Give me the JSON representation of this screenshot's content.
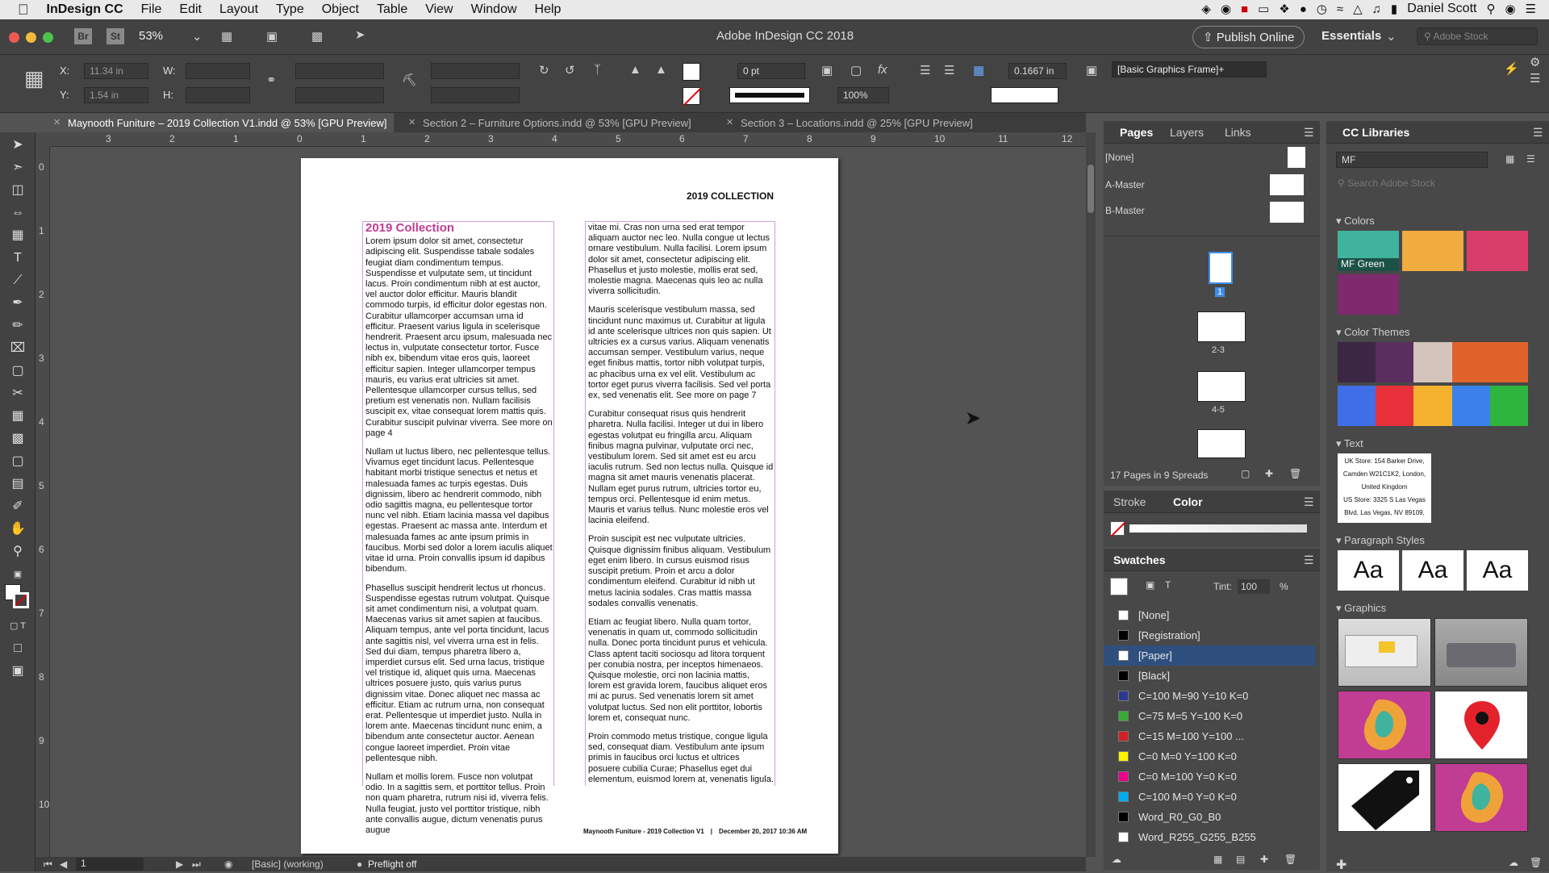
{
  "menubar": {
    "app_name": "InDesign CC",
    "items": [
      "File",
      "Edit",
      "Layout",
      "Type",
      "Object",
      "Table",
      "View",
      "Window",
      "Help"
    ],
    "user": "Daniel Scott"
  },
  "appbar": {
    "bridge": "Br",
    "stock": "St",
    "zoom": "53%",
    "window_title": "Adobe InDesign CC 2018",
    "publish": "Publish Online",
    "workspace": "Essentials",
    "search_placeholder": "Adobe Stock"
  },
  "control": {
    "x_label": "X:",
    "x_value": "11.34 in",
    "y_label": "Y:",
    "y_value": "1.54 in",
    "w_label": "W:",
    "h_label": "H:",
    "stroke_weight": "0 pt",
    "opacity": "100%",
    "gap": "0.1667 in",
    "object_style": "[Basic Graphics Frame]+"
  },
  "tabs": [
    "Maynooth Funiture – 2019 Collection V1.indd @ 53% [GPU Preview]",
    "Section 2 – Furniture Options.indd @ 53% [GPU Preview]",
    "Section 3 – Locations.indd @ 25% [GPU Preview]"
  ],
  "rulers": {
    "h": [
      "4",
      "3",
      "2",
      "1",
      "0",
      "1",
      "2",
      "3",
      "4",
      "5",
      "6",
      "7",
      "8",
      "9",
      "10",
      "11",
      "12"
    ],
    "v": [
      "0",
      "1",
      "2",
      "3",
      "4",
      "5",
      "6",
      "7",
      "8",
      "9",
      "10"
    ]
  },
  "document": {
    "header": "2019 COLLECTION",
    "title": "2019 Collection",
    "left_paras": [
      "Lorem ipsum dolor sit amet, consectetur adipiscing elit. Suspendisse tabale sodales feugiat diam condimentum tempus. Suspendisse et vulputate sem, ut tincidunt lacus. Proin condimentum nibh at est auctor, vel auctor dolor efficitur. Mauris blandit commodo turpis, id efficitur dolor egestas non. Curabitur ullamcorper accumsan urna id efficitur. Praesent varius ligula in scelerisque hendrerit. Praesent arcu ipsum, malesuada nec lectus in, vulputate consectetur tortor. Fusce nibh ex, bibendum vitae eros quis, laoreet efficitur sapien. Integer ullamcorper tempus mauris, eu varius erat ultricies sit amet. Pellentesque ullamcorper cursus tellus, sed pretium est venenatis non. Nullam facilisis suscipit ex, vitae consequat lorem mattis quis. Curabitur suscipit pulvinar viverra. See more on page 4",
      "Nullam ut luctus libero, nec pellentesque tellus. Vivamus eget tincidunt lacus. Pellentesque habitant morbi tristique senectus et netus et malesuada fames ac turpis egestas. Duis dignissim, libero ac hendrerit commodo, nibh odio sagittis magna, eu pellentesque tortor nunc vel nibh. Etiam lacinia massa vel dapibus egestas. Praesent ac massa ante. Interdum et malesuada fames ac ante ipsum primis in faucibus. Morbi sed dolor a lorem iaculis aliquet vitae id urna. Proin convallis ipsum id dapibus bibendum.",
      "Phasellus suscipit hendrerit lectus ut rhoncus. Suspendisse egestas rutrum volutpat. Quisque sit amet condimentum nisi, a volutpat quam. Maecenas varius sit amet sapien at faucibus. Aliquam tempus, ante vel porta tincidunt, lacus ante sagittis nisl, vel viverra urna est in felis. Sed dui diam, tempus pharetra libero a, imperdiet cursus elit. Sed urna lacus, tristique vel tristique id, aliquet quis urna. Maecenas ultrices posuere justo, quis varius purus dignissim vitae. Donec aliquet nec massa ac efficitur. Etiam ac rutrum urna, non consequat erat. Pellentesque ut imperdiet justo. Nulla in lorem ante. Maecenas tincidunt nunc enim, a bibendum ante consectetur auctor. Aenean congue laoreet imperdiet. Proin vitae pellentesque nibh.",
      "Nullam et mollis lorem. Fusce non volutpat odio. In a sagittis sem, et porttitor tellus. Proin non quam pharetra, rutrum nisi id, viverra felis. Nulla feugiat, justo vel porttitor tristique, nibh ante convallis augue, dictum venenatis purus augue"
    ],
    "right_paras": [
      "vitae mi. Cras non urna sed erat tempor aliquam auctor nec leo. Nulla congue ut lectus ornare vestibulum. Nulla facilisi. Lorem ipsum dolor sit amet, consectetur adipiscing elit. Phasellus et justo molestie, mollis erat sed, molestie magna. Maecenas quis leo ac nulla viverra sollicitudin.",
      "Mauris scelerisque vestibulum massa, sed tincidunt nunc maximus ut. Curabitur at ligula id ante scelerisque ultrices non quis sapien. Ut ultricies ex a cursus varius. Aliquam venenatis accumsan semper. Vestibulum varius, neque eget finibus mattis, tortor nibh volutpat turpis, ac phacibus urna ex vel elit. Vestibulum ac tortor eget purus viverra facilisis. Sed vel porta ex, sed venenatis elit. See more on page 7",
      "Curabitur consequat risus quis hendrerit pharetra. Nulla facilisi. Integer ut dui in libero egestas volutpat eu fringilla arcu. Aliquam finibus magna pulvinar, vulputate orci nec, vestibulum lorem. Sed sit amet est eu arcu iaculis rutrum. Sed non lectus nulla. Quisque id magna sit amet mauris venenatis placerat. Nullam eget purus rutrum, ultricies tortor eu, tempus orci. Pellentesque id enim metus. Mauris et varius tellus. Nunc molestie eros vel lacinia eleifend.",
      "Proin suscipit est nec vulputate ultricies. Quisque dignissim finibus aliquam. Vestibulum eget enim libero. In cursus euismod risus suscipit pretium. Proin et arcu a dolor condimentum eleifend. Curabitur id nibh ut metus lacinia sodales. Cras mattis massa sodales convallis venenatis.",
      "Etiam ac feugiat libero. Nulla quam tortor, venenatis in quam ut, commodo sollicitudin nulla. Donec porta tincidunt purus et vehicula. Class aptent taciti sociosqu ad litora torquent per conubia nostra, per inceptos himenaeos. Quisque molestie, orci non lacinia mattis, lorem est gravida lorem, faucibus aliquet eros mi ac purus. Sed venenatis lorem sit amet volutpat luctus. Sed non elit porttitor, lobortis lorem et, consequat nunc.",
      "Proin commodo metus tristique, congue ligula sed, consequat diam. Vestibulum ante ipsum primis in faucibus orci luctus et ultrices posuere cubilia Curae; Phasellus eget dui elementum, euismod lorem at, venenatis ligula. Vivamus eget laoreet nisi. Ut metus ante, bibendum sed arcu id, semper convallis tellus. Suspendisse potenti. Pellentesque habitant morbi tristique senectus et netus et malesuada fames ac turpis"
    ],
    "footer_left": "Maynooth Funiture - 2019 Collection V1",
    "footer_sep": "|",
    "footer_right": "December 20, 2017 10:36 AM"
  },
  "status": {
    "page": "1",
    "style": "[Basic] (working)",
    "preflight": "Preflight off"
  },
  "pages_panel": {
    "tabs": [
      "Pages",
      "Layers",
      "Links"
    ],
    "masters": [
      "[None]",
      "A-Master",
      "B-Master"
    ],
    "spreads": [
      "1",
      "2-3",
      "4-5"
    ],
    "summary": "17 Pages in 9 Spreads"
  },
  "color_panel": {
    "tabs": [
      "Stroke",
      "Color"
    ]
  },
  "swatches_panel": {
    "title": "Swatches",
    "tint_label": "Tint:",
    "tint_value": "100",
    "tint_unit": "%",
    "items": [
      {
        "name": "[None]",
        "color": "#ffffff"
      },
      {
        "name": "[Registration]",
        "color": "#000000"
      },
      {
        "name": "[Paper]",
        "color": "#ffffff"
      },
      {
        "name": "[Black]",
        "color": "#000000"
      },
      {
        "name": "C=100 M=90 Y=10 K=0",
        "color": "#2b3990"
      },
      {
        "name": "C=75 M=5 Y=100 K=0",
        "color": "#3aa935"
      },
      {
        "name": "C=15 M=100 Y=100 ...",
        "color": "#d12027"
      },
      {
        "name": "C=0 M=0 Y=100 K=0",
        "color": "#fff200"
      },
      {
        "name": "C=0 M=100 Y=0 K=0",
        "color": "#ec008c"
      },
      {
        "name": "C=100 M=0 Y=0 K=0",
        "color": "#00aeef"
      },
      {
        "name": "Word_R0_G0_B0",
        "color": "#000000"
      },
      {
        "name": "Word_R255_G255_B255",
        "color": "#ffffff"
      }
    ],
    "selected_index": 2
  },
  "cc_libraries": {
    "title": "CC Libraries",
    "library": "MF",
    "search_placeholder": "Search Adobe Stock",
    "colors_title": "Colors",
    "colors": [
      "#3fb39e",
      "#f0ac3e",
      "#d93e6a",
      "#7e2a6d"
    ],
    "first_color_name": "MF Green",
    "themes_title": "Color Themes",
    "theme1": [
      "#3b2744",
      "#5a2e5e",
      "#d5c4bc",
      "#e0632c",
      "#e0632c"
    ],
    "theme2": [
      "#3f6ee8",
      "#e8303a",
      "#f4b22e",
      "#3a82ea",
      "#2db53d"
    ],
    "text_title": "Text",
    "text_lines": [
      "UK Store: 154 Barker Drive,",
      "Camden W21C1K2, London,",
      "United Kingdom",
      "US Store: 3325 S Las Vegas",
      "Blvd, Las Vegas, NV 89109,"
    ],
    "para_title": "Paragraph Styles",
    "para_sample": "Aa",
    "graphics_title": "Graphics"
  }
}
